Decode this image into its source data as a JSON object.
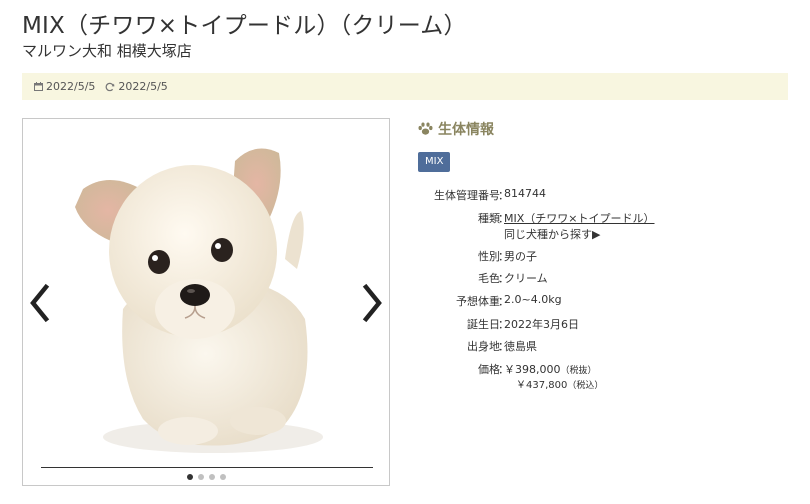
{
  "header": {
    "title": "MIX（チワワ×トイプードル）（クリーム）",
    "store": "マルワン大和 相模大塚店"
  },
  "dates": {
    "published": "2022/5/5",
    "updated": "2022/5/5"
  },
  "gallery": {
    "slide_count": 4,
    "active_index": 0
  },
  "info": {
    "heading": "生体情報",
    "badge": "MIX",
    "rows": {
      "id": {
        "label": "生体管理番号",
        "value": "814744"
      },
      "breed": {
        "label": "種類",
        "link1": "MIX（チワワ×トイプードル）",
        "link2": "同じ犬種から探す▶"
      },
      "sex": {
        "label": "性別",
        "value": "男の子"
      },
      "color": {
        "label": "毛色",
        "value": "クリーム"
      },
      "weight": {
        "label": "予想体重",
        "value": "2.0~4.0kg"
      },
      "birthday": {
        "label": "誕生日",
        "value": "2022年3月6日"
      },
      "origin": {
        "label": "出身地",
        "value": "徳島県"
      },
      "price": {
        "label": "価格",
        "value": "￥398,000",
        "note": "（税抜）",
        "incl": "￥437,800",
        "incl_note": "（税込）"
      }
    }
  },
  "colors": {
    "date_bar_bg": "#f8f6e0",
    "heading_color": "#8a8560",
    "badge_bg": "#4f6d9a"
  },
  "icons": [
    "calendar-icon",
    "refresh-icon",
    "paw-icon",
    "chevron-left-icon",
    "chevron-right-icon"
  ]
}
